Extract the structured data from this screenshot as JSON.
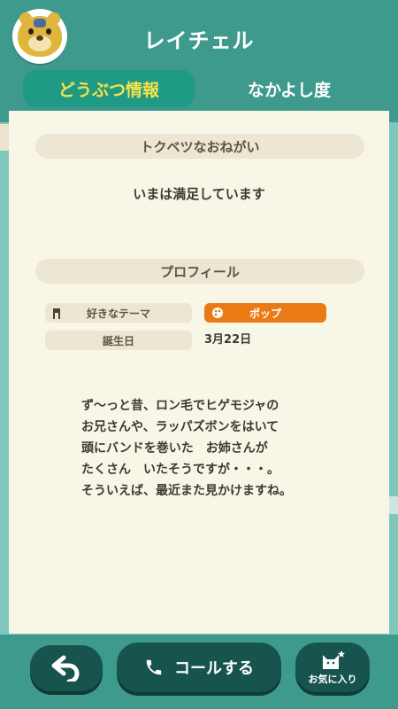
{
  "villager": {
    "name": "レイチェル"
  },
  "tabs": {
    "info": "どうぶつ情報",
    "friendship": "なかよし度"
  },
  "request": {
    "title": "トクベツなおねがい",
    "text": "いまは満足しています"
  },
  "profile": {
    "title": "プロフィール",
    "theme_label": "好きなテーマ",
    "theme_value": "ポップ",
    "birthday_label": "誕生日",
    "birthday_value": "3月22日",
    "description": [
      "ず〜っと昔、ロン毛でヒゲモジャの",
      "お兄さんや、ラッパズボンをはいて",
      "頭にバンドを巻いた　お姉さんが",
      "たくさん　いたそうですが・・・。",
      "そういえば、最近また見かけますね。"
    ]
  },
  "footer": {
    "call_label": "コールする",
    "favorite_label": "お気に入り"
  },
  "colors": {
    "header": "#3f9a8e",
    "active_tab": "#1f9a84",
    "tab_text_active": "#f7e24a",
    "theme_pill": "#ea7a16",
    "button": "#17544e"
  },
  "icons": {
    "avatar": "bear-cub-avatar",
    "theme": "hanger-icon",
    "pop": "paint-palette-icon",
    "back": "back-arrow-icon",
    "call": "phone-icon",
    "favorite": "cat-star-icon"
  }
}
